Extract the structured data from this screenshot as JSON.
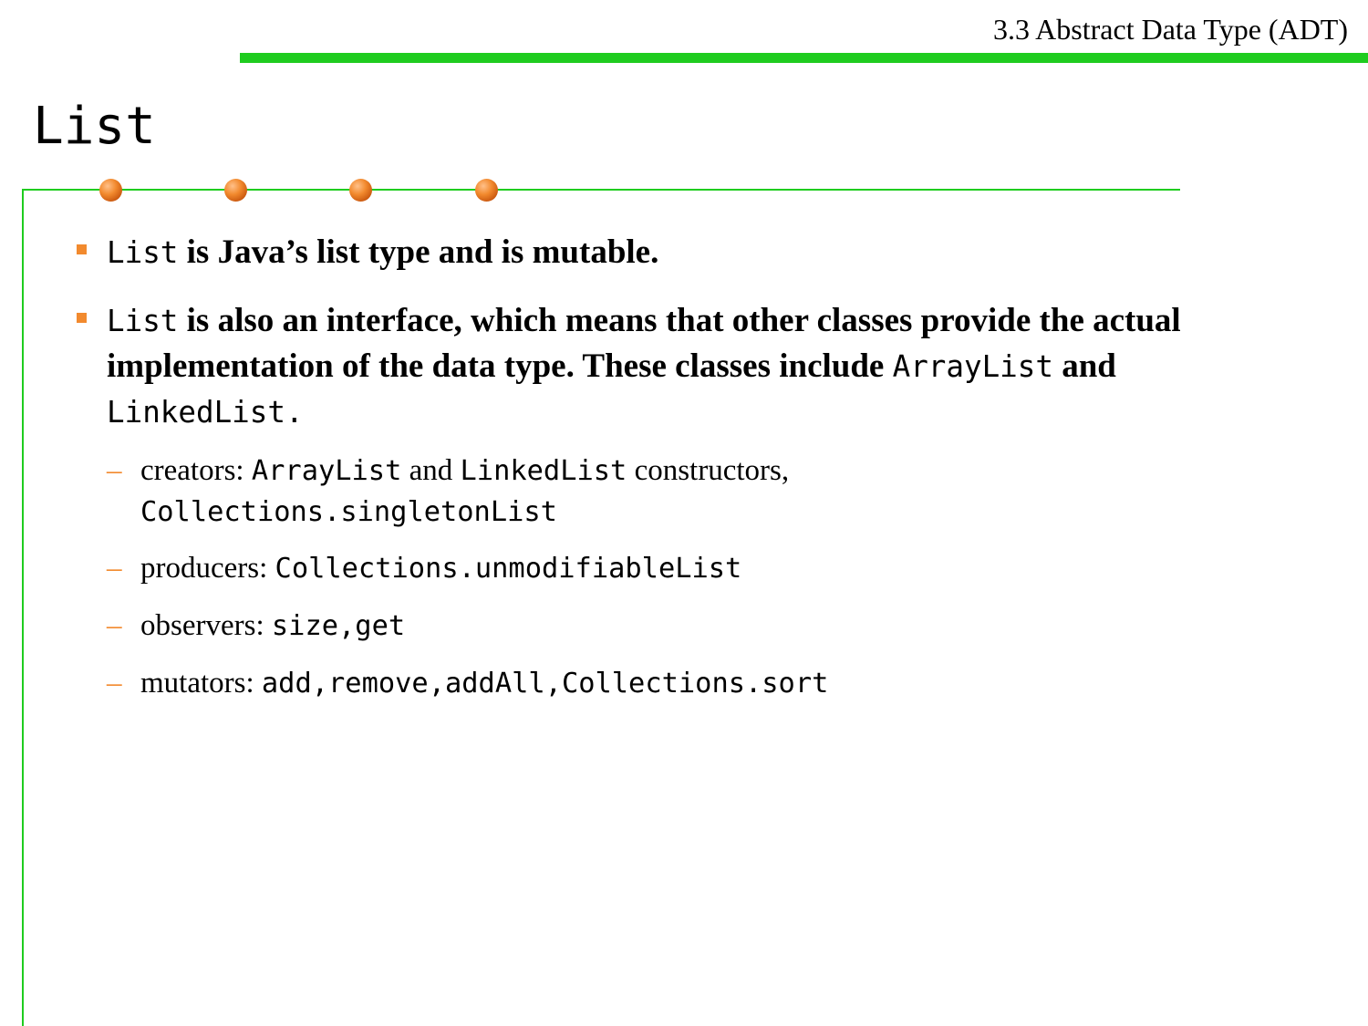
{
  "header": {
    "section_title": "3.3 Abstract Data Type (ADT)"
  },
  "slide": {
    "title": "List"
  },
  "bullets": [
    {
      "code1": "List",
      "text1": " is Java’s list type and is mutable."
    },
    {
      "code1": "List",
      "text1": " is also an interface, which means that other classes provide the actual implementation of the data type. These classes include ",
      "code2": "ArrayList",
      "text2": " and ",
      "code3": "LinkedList",
      "text3": "."
    }
  ],
  "sub_items": [
    {
      "label": "creators: ",
      "code1": "ArrayList",
      "text1": " and ",
      "code2": "LinkedList",
      "text2": " constructors,",
      "code3": "Collections.singletonList"
    },
    {
      "label": "producers: ",
      "code1": "Collections.unmodifiableList"
    },
    {
      "label": "observers: ",
      "code1": "size",
      "sep1": ",",
      "code2": "get"
    },
    {
      "label": "mutators: ",
      "code1": "add",
      "sep1": ",",
      "code2": "remove",
      "sep2": ",",
      "code3": "addAll",
      "sep3": ",",
      "code4": "Collections.sort"
    }
  ],
  "dash_glyph": "–",
  "colors": {
    "accent_green": "#1fcc1f",
    "accent_orange": "#f28a2e"
  }
}
